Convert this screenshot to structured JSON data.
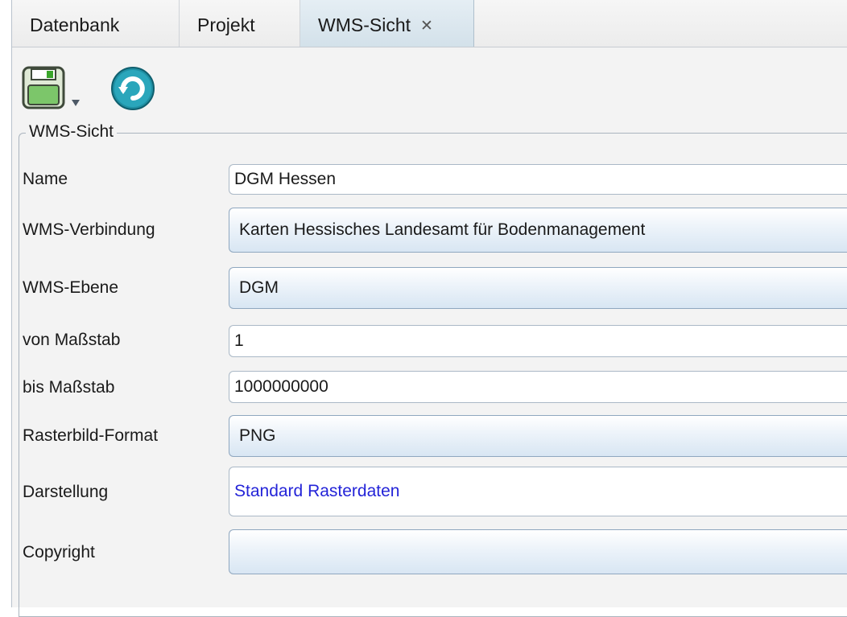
{
  "tabs": [
    {
      "label": "Datenbank"
    },
    {
      "label": "Projekt"
    },
    {
      "label": "WMS-Sicht",
      "close": "✕"
    }
  ],
  "toolbar": {
    "save_icon": "floppy-disk-icon",
    "refresh_icon": "refresh-icon"
  },
  "group": {
    "title": "WMS-Sicht",
    "fields": [
      {
        "label": "Name",
        "value": "DGM Hessen"
      },
      {
        "label": "WMS-Verbindung",
        "value": "Karten Hessisches Landesamt für Bodenmanagement"
      },
      {
        "label": "WMS-Ebene",
        "value": "DGM"
      },
      {
        "label": "von Maßstab",
        "value": "1"
      },
      {
        "label": "bis Maßstab",
        "value": "1000000000"
      },
      {
        "label": "Rasterbild-Format",
        "value": "PNG"
      },
      {
        "label": "Darstellung",
        "value": "Standard Rasterdaten"
      },
      {
        "label": "Copyright",
        "value": ""
      }
    ]
  }
}
